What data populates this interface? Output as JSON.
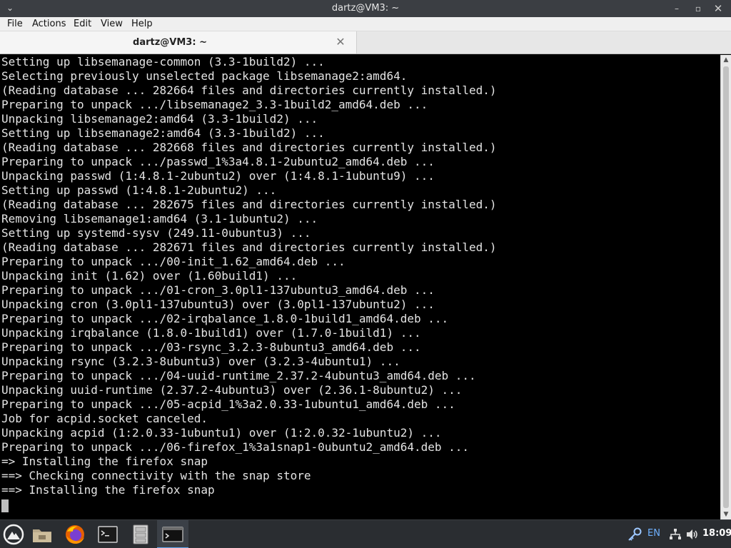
{
  "window": {
    "title": "dartz@VM3: ~",
    "menu_glyph": "⌄",
    "min_glyph": "–",
    "max_glyph": "▫",
    "close_glyph": "✕"
  },
  "menubar": {
    "items": [
      "File",
      "Actions",
      "Edit",
      "View",
      "Help"
    ]
  },
  "tab": {
    "label": "dartz@VM3: ~",
    "close_glyph": "✕"
  },
  "terminal": {
    "lines": [
      "Setting up libsemanage-common (3.3-1build2) ...",
      "Selecting previously unselected package libsemanage2:amd64.",
      "(Reading database ... 282664 files and directories currently installed.)",
      "Preparing to unpack .../libsemanage2_3.3-1build2_amd64.deb ...",
      "Unpacking libsemanage2:amd64 (3.3-1build2) ...",
      "Setting up libsemanage2:amd64 (3.3-1build2) ...",
      "(Reading database ... 282668 files and directories currently installed.)",
      "Preparing to unpack .../passwd_1%3a4.8.1-2ubuntu2_amd64.deb ...",
      "Unpacking passwd (1:4.8.1-2ubuntu2) over (1:4.8.1-1ubuntu9) ...",
      "Setting up passwd (1:4.8.1-2ubuntu2) ...",
      "(Reading database ... 282675 files and directories currently installed.)",
      "Removing libsemanage1:amd64 (3.1-1ubuntu2) ...",
      "Setting up systemd-sysv (249.11-0ubuntu3) ...",
      "(Reading database ... 282671 files and directories currently installed.)",
      "Preparing to unpack .../00-init_1.62_amd64.deb ...",
      "Unpacking init (1.62) over (1.60build1) ...",
      "Preparing to unpack .../01-cron_3.0pl1-137ubuntu3_amd64.deb ...",
      "Unpacking cron (3.0pl1-137ubuntu3) over (3.0pl1-137ubuntu2) ...",
      "Preparing to unpack .../02-irqbalance_1.8.0-1build1_amd64.deb ...",
      "Unpacking irqbalance (1.8.0-1build1) over (1.7.0-1build1) ...",
      "Preparing to unpack .../03-rsync_3.2.3-8ubuntu3_amd64.deb ...",
      "Unpacking rsync (3.2.3-8ubuntu3) over (3.2.3-4ubuntu1) ...",
      "Preparing to unpack .../04-uuid-runtime_2.37.2-4ubuntu3_amd64.deb ...",
      "Unpacking uuid-runtime (2.37.2-4ubuntu3) over (2.36.1-8ubuntu2) ...",
      "Preparing to unpack .../05-acpid_1%3a2.0.33-1ubuntu1_amd64.deb ...",
      "Job for acpid.socket canceled.",
      "Unpacking acpid (1:2.0.33-1ubuntu1) over (1:2.0.32-1ubuntu2) ...",
      "Preparing to unpack .../06-firefox_1%3a1snap1-0ubuntu2_amd64.deb ...",
      "=> Installing the firefox snap",
      "==> Checking connectivity with the snap store",
      "==> Installing the firefox snap"
    ]
  },
  "scrollbar": {
    "up_glyph": "▲",
    "down_glyph": "▼"
  },
  "taskbar": {
    "icons": [
      "start-menu-icon",
      "file-manager-icon",
      "firefox-icon",
      "terminal-icon",
      "file-cabinet-icon",
      "active-terminal-icon"
    ],
    "tray": {
      "language": "EN",
      "clock": "18:09"
    }
  },
  "colors": {
    "titlebar": "#3b3e43",
    "terminal_bg": "#000000",
    "terminal_fg": "#e4e4e4",
    "taskbar": "#2a2d31"
  }
}
